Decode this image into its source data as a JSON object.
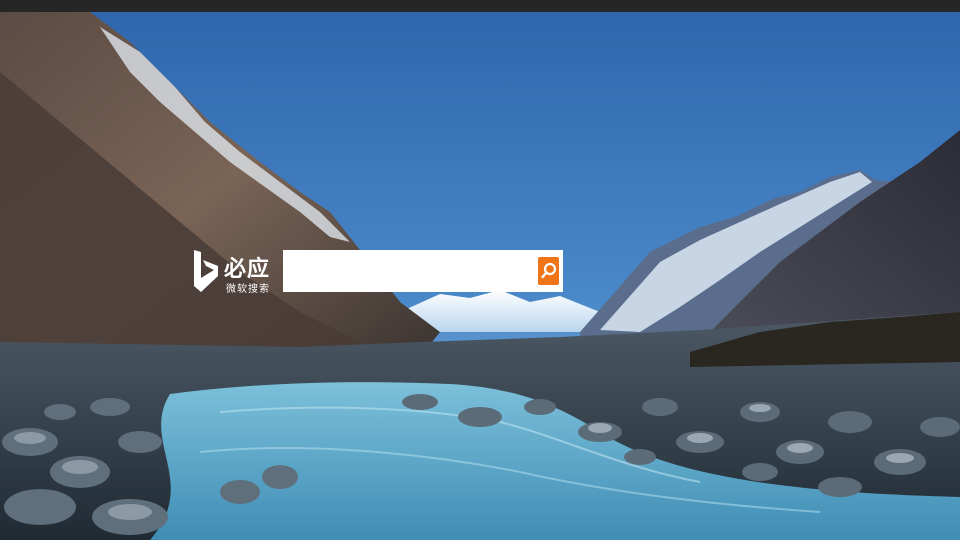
{
  "brand": {
    "name": "必应",
    "subtitle": "微软搜索",
    "logo_icon": "bing-b-logo-icon"
  },
  "search": {
    "value": "",
    "placeholder": "",
    "button_icon": "search-icon",
    "button_color": "#ef7518"
  },
  "background": {
    "sky_color": "#3d7bc4",
    "river_color": "#6fb3cf"
  }
}
